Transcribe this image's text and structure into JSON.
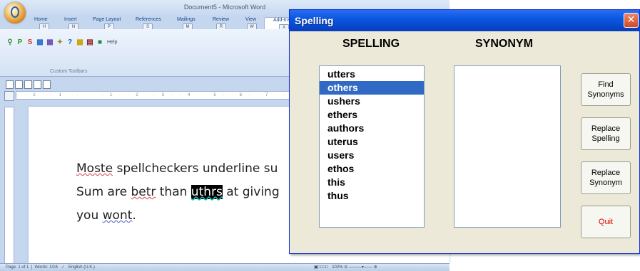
{
  "word": {
    "title": "Document5 - Microsoft Word",
    "tabs": [
      {
        "label": "Home",
        "key": "H"
      },
      {
        "label": "Insert",
        "key": "N"
      },
      {
        "label": "Page Layout",
        "key": "P"
      },
      {
        "label": "References",
        "key": "S"
      },
      {
        "label": "Mailings",
        "key": "M"
      },
      {
        "label": "Review",
        "key": "R"
      },
      {
        "label": "View",
        "key": "W"
      },
      {
        "label": "Add-Ins",
        "key": "X"
      }
    ],
    "toolbar_help": "Help",
    "group_label": "Custom Toolbars",
    "document": {
      "line1_a": "Moste",
      "line1_b": " spellcheckers underline su",
      "line2_a": "Sum are ",
      "line2_b": "betr",
      "line2_c": " than ",
      "line2_d": "uthrs",
      "line2_e": " at giving",
      "line3_a": "you ",
      "line3_b": "wont",
      "line3_c": "."
    },
    "status": {
      "page": "Page: 1 of 1",
      "words": "Words: 1/16",
      "language": "English (U.K.)",
      "zoom": "102%"
    }
  },
  "dialog": {
    "title": "Spelling",
    "spelling_heading": "SPELLING",
    "synonym_heading": "SYNONYM",
    "suggestions": [
      "utters",
      "others",
      "ushers",
      "ethers",
      "authors",
      "uterus",
      "users",
      "ethos",
      "this",
      "thus"
    ],
    "selected_index": 1,
    "synonyms": [],
    "buttons": {
      "find": "Find\nSynonyms",
      "replace_spelling": "Replace\nSpelling",
      "replace_synonym": "Replace\nSynonym",
      "quit": "Quit"
    },
    "colors": {
      "title_bar": "#0b58e0",
      "selection": "#316ac5",
      "quit_text": "#d40000",
      "close_button": "#d14a21"
    }
  }
}
